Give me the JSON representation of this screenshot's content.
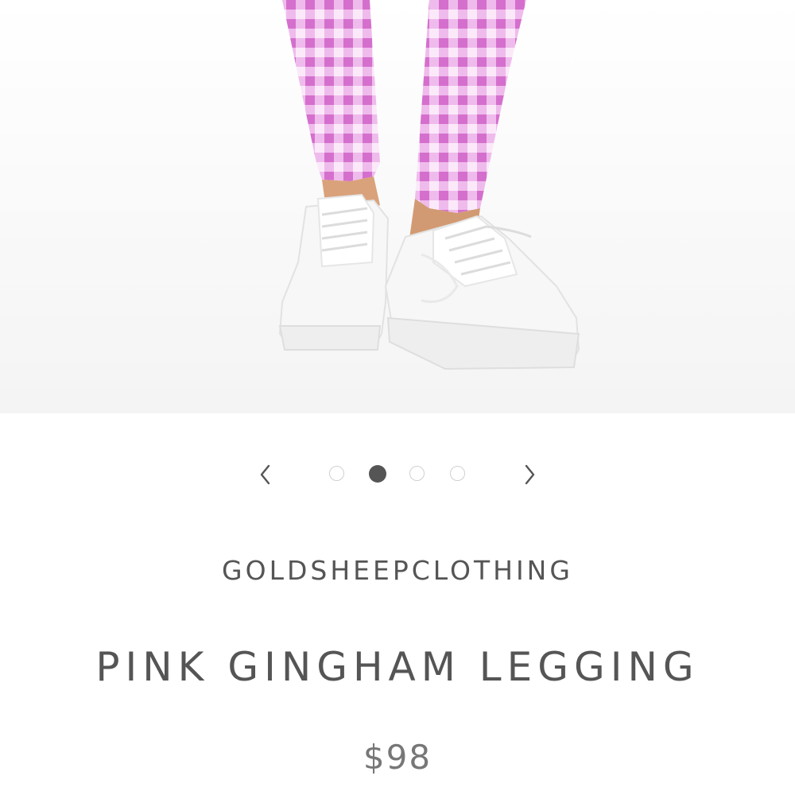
{
  "product_image": {
    "subject": "pink gingham leggings with white sneakers",
    "colors": {
      "gingham_pink": "#e07fd9",
      "gingham_light": "#f2c3ef",
      "sneaker": "#f7f7f7",
      "skin": "#d9a27a",
      "background": "#fbfbfb"
    }
  },
  "carousel": {
    "prev_icon": "chevron-left-icon",
    "next_icon": "chevron-right-icon",
    "slide_count": 4,
    "active_index": 1
  },
  "product": {
    "brand": "GOLDSHEEPCLOTHING",
    "title": "PINK GINGHAM LEGGING",
    "price": "$98"
  },
  "colors": {
    "text": "#555555",
    "price_text": "#777777",
    "dot_inactive_border": "#d0d0d0",
    "dot_active": "#555555"
  }
}
